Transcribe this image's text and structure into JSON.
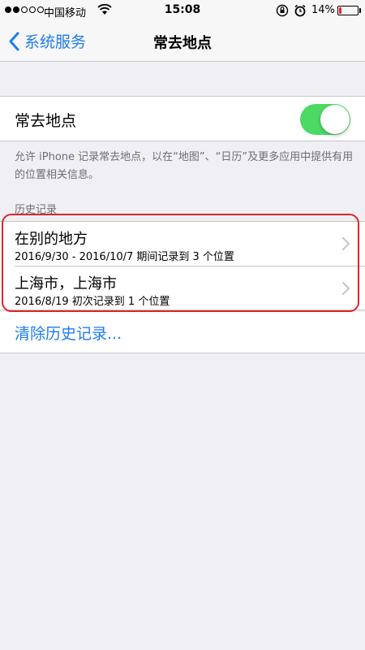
{
  "status_bar": {
    "carrier": "中国移动",
    "time": "15:08",
    "battery_percent": "14%",
    "battery_level": 0.14,
    "signal_bars_filled": 2,
    "signal_bars_total": 5,
    "icons": [
      "wifi-icon",
      "orientation-lock-icon",
      "alarm-icon",
      "battery-icon"
    ]
  },
  "nav": {
    "back_label": "系统服务",
    "title": "常去地点"
  },
  "setting": {
    "label": "常去地点",
    "enabled": true,
    "description": "允许 iPhone 记录常去地点，以在“地图”、“日历”及更多应用中提供有用的位置相关信息。"
  },
  "history": {
    "header": "历史记录",
    "items": [
      {
        "title": "在别的地方",
        "subtitle": "2016/9/30 - 2016/10/7 期间记录到 3 个位置"
      },
      {
        "title": "上海市，上海市",
        "subtitle": "2016/8/19 初次记录到 1 个位置"
      }
    ]
  },
  "clear_history": "清除历史记录...",
  "colors": {
    "accent": "#1e7cf0",
    "switch_on": "#4cd964",
    "highlight": "#e0262b",
    "background": "#efeff4"
  }
}
